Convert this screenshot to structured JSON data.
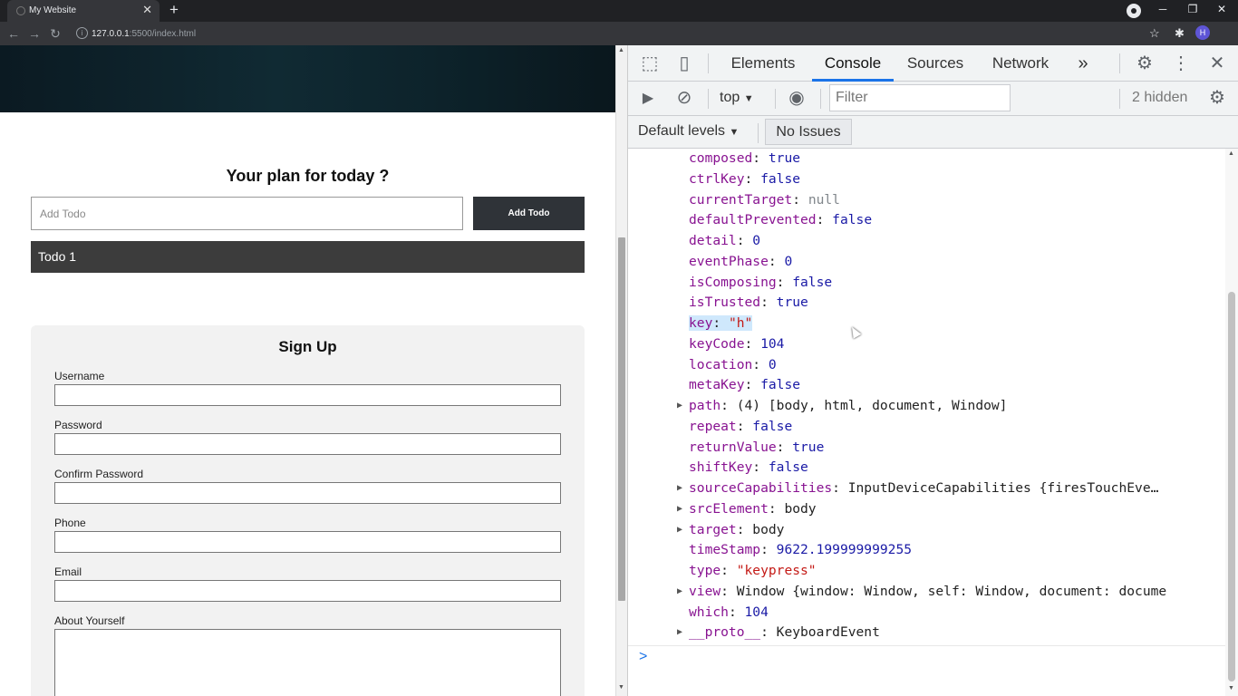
{
  "browser": {
    "tab_title": "My Website",
    "new_tab": "+",
    "url_host": "127.0.0.1",
    "url_rest": ":5500/index.html",
    "profile_initial": "H"
  },
  "page": {
    "plan_title": "Your plan for today ?",
    "todo_placeholder": "Add Todo",
    "add_button": "Add Todo",
    "todo_items": [
      "Todo 1"
    ],
    "signup_title": "Sign Up",
    "fields": [
      "Username",
      "Password",
      "Confirm Password",
      "Phone",
      "Email",
      "About Yourself"
    ]
  },
  "devtools": {
    "tabs": [
      "Elements",
      "Console",
      "Sources",
      "Network"
    ],
    "more": "»",
    "context": "top",
    "filter_placeholder": "Filter",
    "hidden_count": "2 hidden",
    "levels": "Default levels",
    "issues": "No Issues",
    "prompt": ">",
    "lines": [
      {
        "k": "composed",
        "v": "true",
        "t": "vb"
      },
      {
        "k": "ctrlKey",
        "v": "false",
        "t": "vb"
      },
      {
        "k": "currentTarget",
        "v": "null",
        "t": "vg"
      },
      {
        "k": "defaultPrevented",
        "v": "false",
        "t": "vb"
      },
      {
        "k": "detail",
        "v": "0",
        "t": "vn"
      },
      {
        "k": "eventPhase",
        "v": "0",
        "t": "vn"
      },
      {
        "k": "isComposing",
        "v": "false",
        "t": "vb"
      },
      {
        "k": "isTrusted",
        "v": "true",
        "t": "vb"
      },
      {
        "k": "key",
        "v": "\"h\"",
        "t": "vs",
        "hl": true
      },
      {
        "k": "keyCode",
        "v": "104",
        "t": "vn"
      },
      {
        "k": "location",
        "v": "0",
        "t": "vn"
      },
      {
        "k": "metaKey",
        "v": "false",
        "t": "vb"
      },
      {
        "k": "path",
        "v": "(4) [body, html, document, Window]",
        "t": "vt",
        "tri": true
      },
      {
        "k": "repeat",
        "v": "false",
        "t": "vb"
      },
      {
        "k": "returnValue",
        "v": "true",
        "t": "vb"
      },
      {
        "k": "shiftKey",
        "v": "false",
        "t": "vb"
      },
      {
        "k": "sourceCapabilities",
        "v": "InputDeviceCapabilities {firesTouchEve…",
        "t": "vt",
        "tri": true
      },
      {
        "k": "srcElement",
        "v": "body",
        "t": "vt",
        "tri": true
      },
      {
        "k": "target",
        "v": "body",
        "t": "vt",
        "tri": true
      },
      {
        "k": "timeStamp",
        "v": "9622.199999999255",
        "t": "vn"
      },
      {
        "k": "type",
        "v": "\"keypress\"",
        "t": "vs"
      },
      {
        "k": "view",
        "v": "Window {window: Window, self: Window, document: docume",
        "t": "vt",
        "tri": true
      },
      {
        "k": "which",
        "v": "104",
        "t": "vn"
      },
      {
        "k": "__proto__",
        "v": "KeyboardEvent",
        "t": "vt",
        "tri": true
      }
    ]
  }
}
